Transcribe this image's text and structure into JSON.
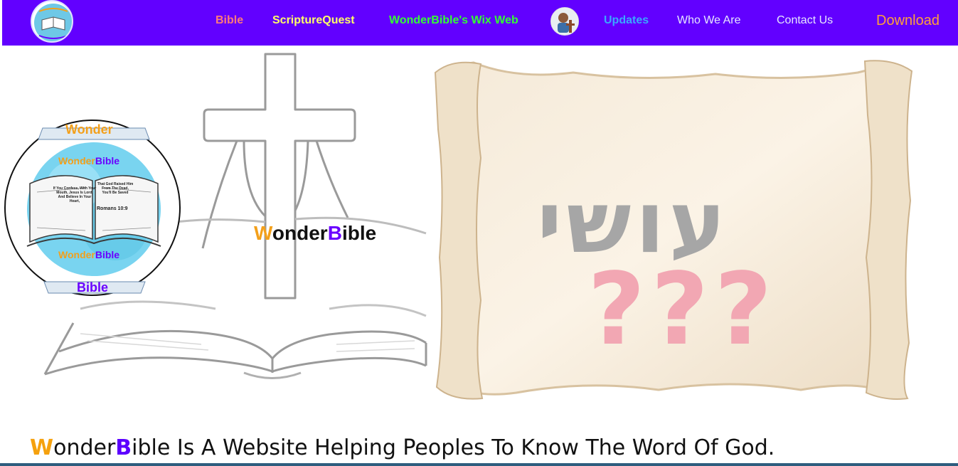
{
  "nav": {
    "links": [
      {
        "label": "Bible",
        "color": "#ff7a7a"
      },
      {
        "label": "ScriptureQuest",
        "color": "#ffff66"
      },
      {
        "label": "WonderBible's Wix Web",
        "color": "#33ff33"
      },
      {
        "label": "Updates",
        "color": "#3aa8ff"
      },
      {
        "label": "Who We Are",
        "color": "#e6e6ff"
      },
      {
        "label": "Contact Us",
        "color": "#e6e6ff"
      },
      {
        "label": "Download",
        "color": "#ff9f3a"
      }
    ],
    "bar_color": "#6200ff"
  },
  "hero": {
    "brand_prefix": "W",
    "brand_middle": "onder",
    "brand_b": "B",
    "brand_suffix": "ible",
    "badge": {
      "top": "Wonder",
      "title_top_prefix": "Wonder",
      "title_top_suffix": "Bible",
      "title_bottom_prefix": "Wonder",
      "title_bottom_suffix": "Bible",
      "bottom": "Bible",
      "verse_left": "If You Confess, With Your Mouth, Jesus Is Lord, And Believe In Your Heart,",
      "verse_right": "That God Raised Him From The Dead, You'll Be Saved",
      "verse_ref": "Romans 10:9"
    },
    "hebrew_text": "עושי",
    "question_marks": "???"
  },
  "tagline": {
    "w": "W",
    "part1": "onder",
    "b": "B",
    "part2": "ible Is A Website Helping Peoples To Know The Word Of God."
  },
  "colors": {
    "accent_orange": "#f5a10e",
    "accent_purple": "#5c00ff"
  }
}
